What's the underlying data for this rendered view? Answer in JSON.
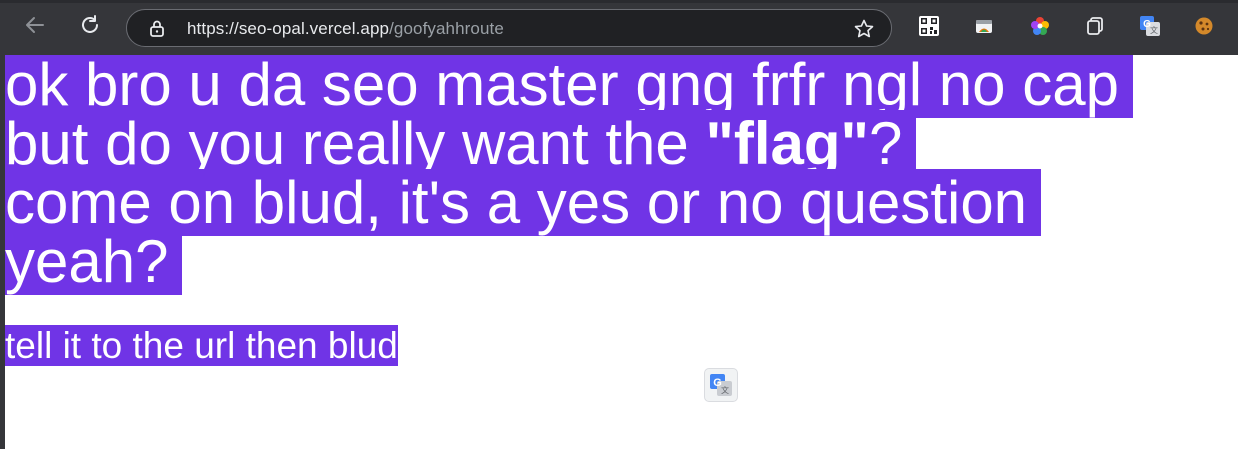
{
  "browser": {
    "url_host": "https://seo-opal.vercel.app",
    "url_path": "/goofyahhroute",
    "extensions": [
      "qr-code-icon",
      "window-icon",
      "color-wheel-icon",
      "copy-icon",
      "google-translate-icon",
      "cookie-icon"
    ]
  },
  "page": {
    "lines": [
      "ok bro u da seo master gng frfr ngl no cap",
      "but do you really want the ",
      "\"flag\"",
      "?",
      "come on blud, it's a yes or no question",
      "yeah?"
    ],
    "subline": "tell it to the url then blud"
  },
  "colors": {
    "highlight": "#7034e6",
    "toolbar": "#35363a"
  }
}
